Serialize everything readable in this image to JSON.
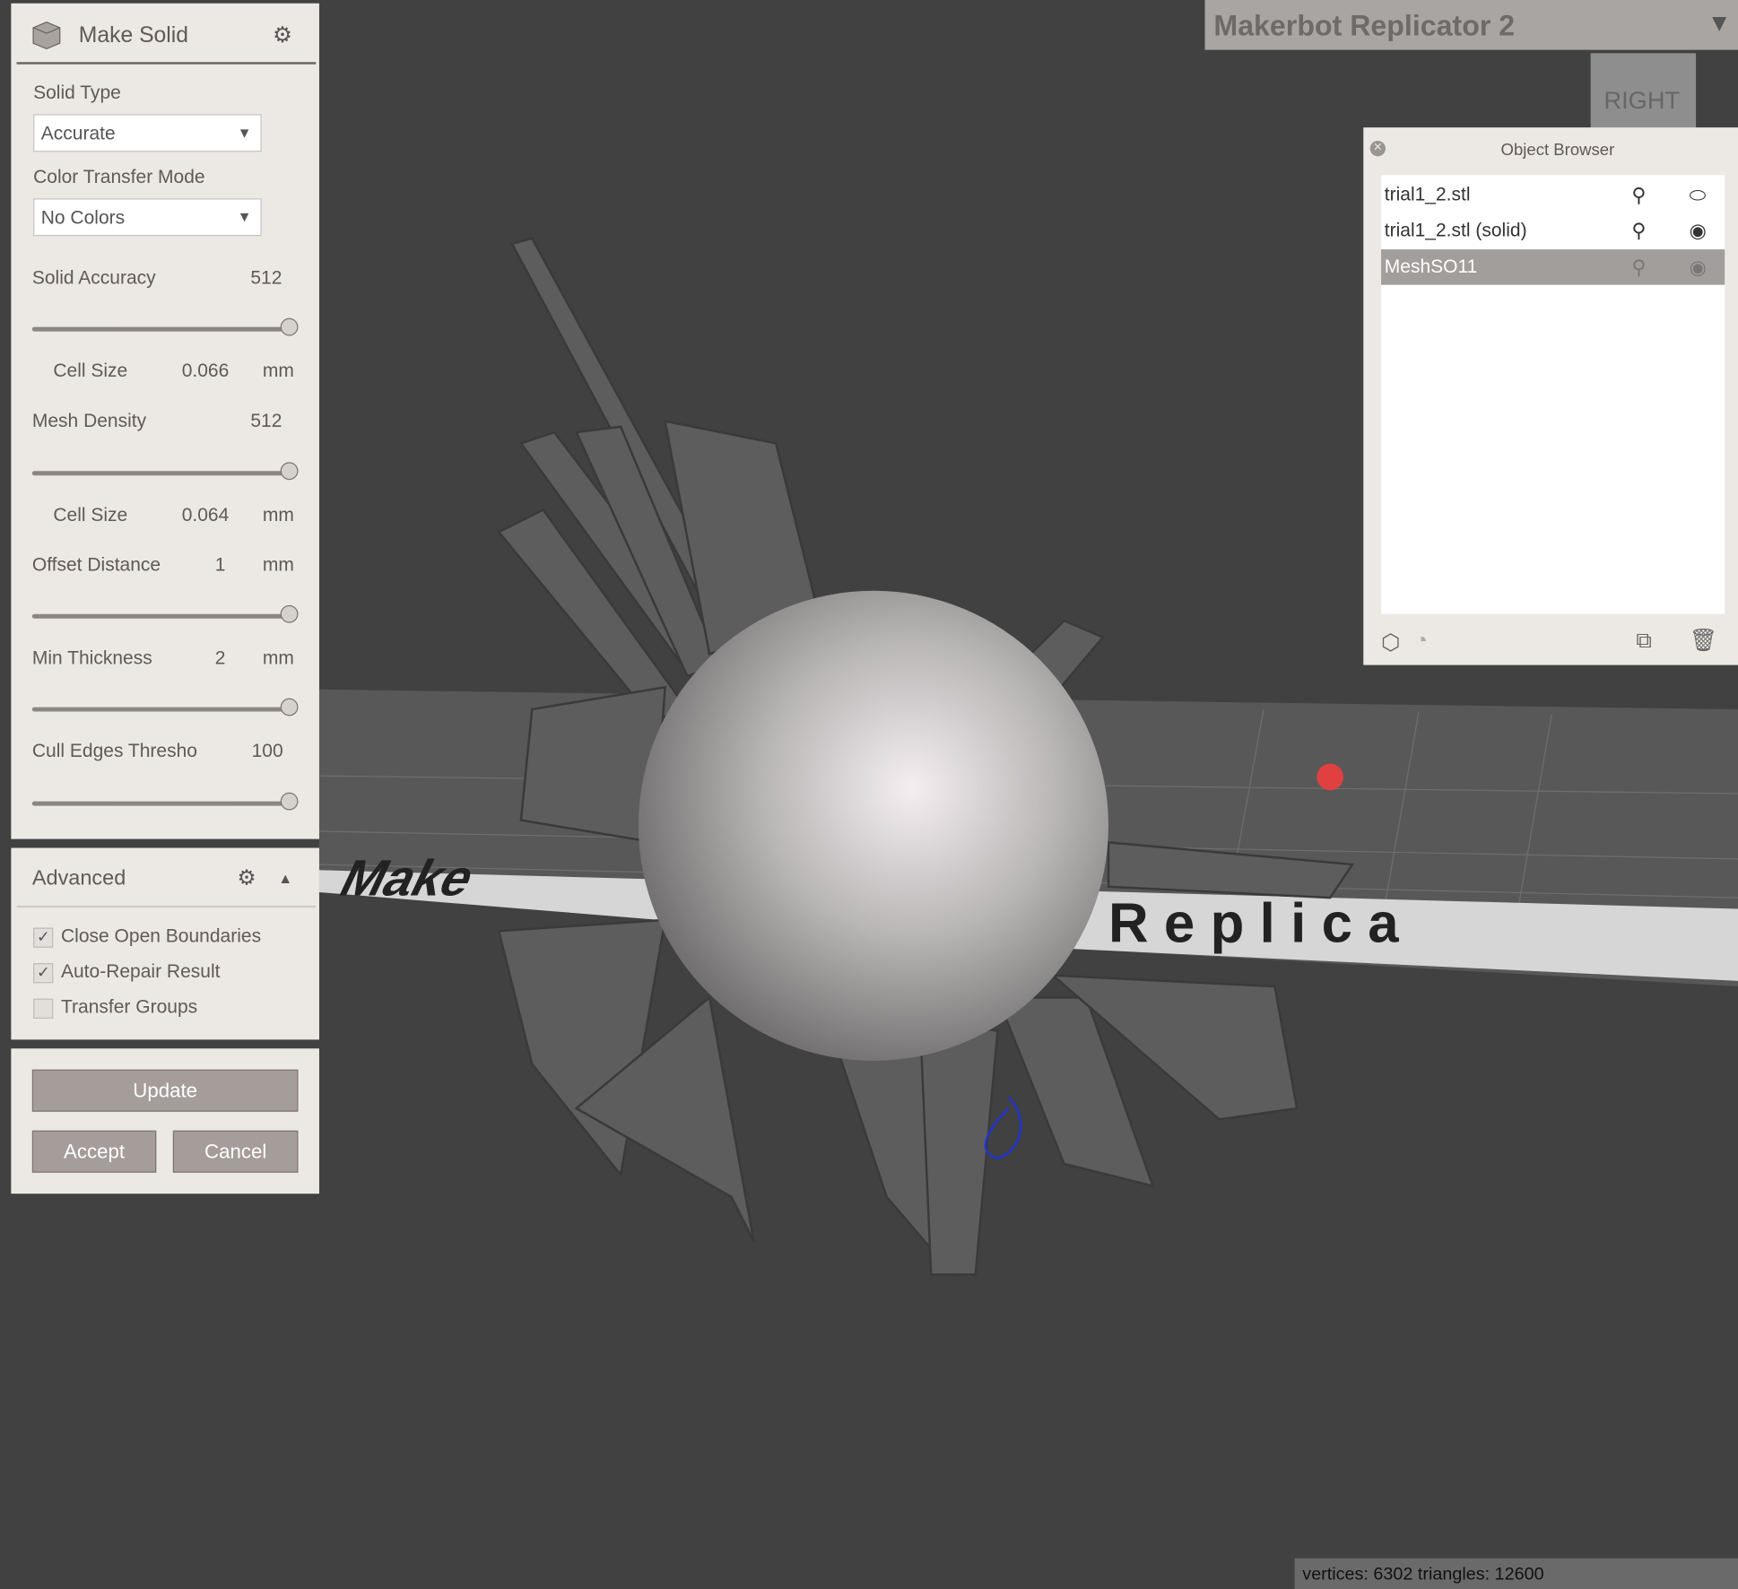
{
  "printer": {
    "name": "Makerbot Replicator 2"
  },
  "view_cube": {
    "face": "RIGHT"
  },
  "make_solid": {
    "title": "Make Solid",
    "solid_type_label": "Solid Type",
    "solid_type_value": "Accurate",
    "color_mode_label": "Color Transfer Mode",
    "color_mode_value": "No Colors",
    "solid_accuracy_label": "Solid Accuracy",
    "solid_accuracy_value": "512",
    "solid_accuracy_level": 1.0,
    "cell_size_1_label": "Cell Size",
    "cell_size_1_value": "0.066",
    "cell_size_1_unit": "mm",
    "mesh_density_label": "Mesh Density",
    "mesh_density_value": "512",
    "mesh_density_level": 1.0,
    "cell_size_2_label": "Cell Size",
    "cell_size_2_value": "0.064",
    "cell_size_2_unit": "mm",
    "offset_label": "Offset Distance",
    "offset_value": "1",
    "offset_unit": "mm",
    "offset_level": 1.0,
    "min_thick_label": "Min Thickness",
    "min_thick_value": "2",
    "min_thick_unit": "mm",
    "min_thick_level": 1.0,
    "cull_label": "Cull Edges Thresho",
    "cull_value": "100",
    "cull_level": 1.0
  },
  "advanced": {
    "title": "Advanced",
    "options": [
      {
        "label": "Close Open Boundaries",
        "checked": true
      },
      {
        "label": "Auto-Repair Result",
        "checked": true
      },
      {
        "label": "Transfer Groups",
        "checked": false
      }
    ]
  },
  "actions": {
    "update": "Update",
    "accept": "Accept",
    "cancel": "Cancel"
  },
  "object_browser": {
    "title": "Object Browser",
    "items": [
      {
        "name": "trial1_2.stl",
        "visible": false,
        "selected": false
      },
      {
        "name": "trial1_2.stl (solid)",
        "visible": true,
        "selected": false
      },
      {
        "name": "MeshSO11",
        "visible": true,
        "selected": true
      }
    ]
  },
  "scene_text": {
    "left": "Make",
    "right": "Replica"
  },
  "status": {
    "text": "vertices: 6302 triangles: 12600"
  },
  "colors": {
    "panel": "#ece8e4",
    "button": "#a59d9a",
    "selected_row": "#a29e9b",
    "viewport": "#414141"
  }
}
